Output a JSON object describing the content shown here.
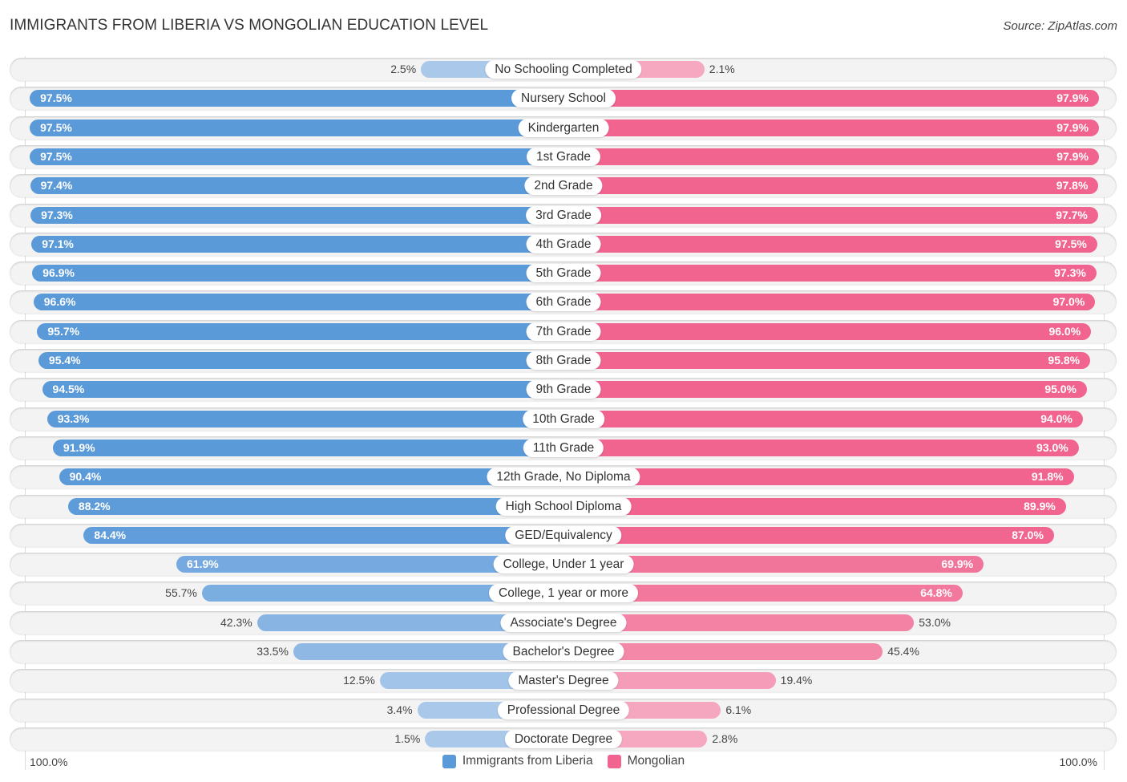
{
  "header": {
    "title": "IMMIGRANTS FROM LIBERIA VS MONGOLIAN EDUCATION LEVEL",
    "source": "Source: ZipAtlas.com"
  },
  "colors": {
    "left_strong": "#5b9ad9",
    "left_light": "#a9c8ea",
    "right_strong": "#f0648f",
    "right_light": "#f6a8c1"
  },
  "chart_data": {
    "type": "bar",
    "title": "IMMIGRANTS FROM LIBERIA VS MONGOLIAN EDUCATION LEVEL",
    "orientation": "horizontal-diverging",
    "xlabel": "",
    "ylabel": "",
    "xlim": [
      0,
      100
    ],
    "axis_min_label": "100.0%",
    "axis_max_label": "100.0%",
    "legend_position": "bottom",
    "categories": [
      "No Schooling Completed",
      "Nursery School",
      "Kindergarten",
      "1st Grade",
      "2nd Grade",
      "3rd Grade",
      "4th Grade",
      "5th Grade",
      "6th Grade",
      "7th Grade",
      "8th Grade",
      "9th Grade",
      "10th Grade",
      "11th Grade",
      "12th Grade, No Diploma",
      "High School Diploma",
      "GED/Equivalency",
      "College, Under 1 year",
      "College, 1 year or more",
      "Associate's Degree",
      "Bachelor's Degree",
      "Master's Degree",
      "Professional Degree",
      "Doctorate Degree"
    ],
    "series": [
      {
        "name": "Immigrants from Liberia",
        "side": "left",
        "values": [
          2.5,
          97.5,
          97.5,
          97.5,
          97.4,
          97.3,
          97.1,
          96.9,
          96.6,
          95.7,
          95.4,
          94.5,
          93.3,
          91.9,
          90.4,
          88.2,
          84.4,
          61.9,
          55.7,
          42.3,
          33.5,
          12.5,
          3.4,
          1.5
        ],
        "labels": [
          "2.5%",
          "97.5%",
          "97.5%",
          "97.5%",
          "97.4%",
          "97.3%",
          "97.1%",
          "96.9%",
          "96.6%",
          "95.7%",
          "95.4%",
          "94.5%",
          "93.3%",
          "91.9%",
          "90.4%",
          "88.2%",
          "84.4%",
          "61.9%",
          "55.7%",
          "42.3%",
          "33.5%",
          "12.5%",
          "3.4%",
          "1.5%"
        ]
      },
      {
        "name": "Mongolian",
        "side": "right",
        "values": [
          2.1,
          97.9,
          97.9,
          97.9,
          97.8,
          97.7,
          97.5,
          97.3,
          97.0,
          96.0,
          95.8,
          95.0,
          94.0,
          93.0,
          91.8,
          89.9,
          87.0,
          69.9,
          64.8,
          53.0,
          45.4,
          19.4,
          6.1,
          2.8
        ],
        "labels": [
          "2.1%",
          "97.9%",
          "97.9%",
          "97.9%",
          "97.8%",
          "97.7%",
          "97.5%",
          "97.3%",
          "97.0%",
          "96.0%",
          "95.8%",
          "95.0%",
          "94.0%",
          "93.0%",
          "91.8%",
          "89.9%",
          "87.0%",
          "69.9%",
          "64.8%",
          "53.0%",
          "45.4%",
          "19.4%",
          "6.1%",
          "2.8%"
        ]
      }
    ]
  },
  "legend": {
    "left_label": "Immigrants from Liberia",
    "right_label": "Mongolian"
  }
}
